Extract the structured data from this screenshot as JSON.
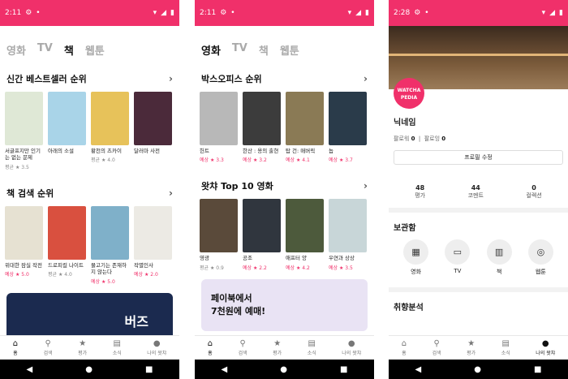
{
  "screen1": {
    "status": {
      "time": "2:11"
    },
    "tabs": [
      "영화",
      "TV",
      "책",
      "웹툰"
    ],
    "section1_title": "신간 베스트셀러 순위",
    "books": [
      {
        "title": "서글프지만 인기는 없는 문제",
        "label": "평균",
        "rating": "★ 3.5"
      },
      {
        "title": "아래의 소설",
        "label": "",
        "rating": ""
      },
      {
        "title": "황천의 츠카이",
        "label": "평균",
        "rating": "★ 4.0"
      },
      {
        "title": "달러마 사전",
        "label": "",
        "rating": ""
      }
    ],
    "section2_title": "책 검색 순위",
    "books2": [
      {
        "title": "위대한 잠실 작전",
        "label": "예상",
        "rating": "★ 5.0"
      },
      {
        "title": "드로피컬 나이트",
        "label": "평균",
        "rating": "★ 4.0"
      },
      {
        "title": "물고기는 존재하지 않는다",
        "label": "예상",
        "rating": "★ 5.0"
      },
      {
        "title": "작별인사",
        "label": "예상",
        "rating": "★ 2.0"
      }
    ],
    "banner_text": "버즈"
  },
  "screen2": {
    "status": {
      "time": "2:11"
    },
    "tabs": [
      "영화",
      "TV",
      "책",
      "웹툰"
    ],
    "section1_title": "박스오피스 순위",
    "movies": [
      {
        "title": "헌트",
        "label": "예상",
        "rating": "★ 3.3"
      },
      {
        "title": "한산 : 용의 출현",
        "label": "예상",
        "rating": "★ 3.2"
      },
      {
        "title": "탑 건: 매버릭",
        "label": "예상",
        "rating": "★ 4.1"
      },
      {
        "title": "놉",
        "label": "예상",
        "rating": "★ 3.7"
      }
    ],
    "section2_title": "왓챠 Top 10 영화",
    "movies2": [
      {
        "title": "영광",
        "label": "평균",
        "rating": "★ 0.9"
      },
      {
        "title": "공조",
        "label": "예상",
        "rating": "★ 2.2"
      },
      {
        "title": "애프터 양",
        "label": "예상",
        "rating": "★ 4.2"
      },
      {
        "title": "우연과 상상",
        "label": "예상",
        "rating": "★ 3.5"
      }
    ],
    "banner_line1": "페이북에서",
    "banner_line2": "7천원에 예매!"
  },
  "screen3": {
    "status": {
      "time": "2:28"
    },
    "logo": "WATCHA PEDIA",
    "nickname": "닉네임",
    "follower_label": "팔로워",
    "follower_count": "0",
    "following_label": "팔로잉",
    "following_count": "0",
    "edit_button": "프로필 수정",
    "stats": [
      {
        "n": "48",
        "l": "평가"
      },
      {
        "n": "44",
        "l": "코멘트"
      },
      {
        "n": "0",
        "l": "컬렉션"
      }
    ],
    "storage_title": "보관함",
    "storage": [
      "영화",
      "TV",
      "책",
      "웹툰"
    ],
    "taste_title": "취향분석"
  },
  "bottom_nav": [
    "홈",
    "검색",
    "평가",
    "소식",
    "나의 왓챠"
  ],
  "colors": {
    "accent": "#f0306a"
  }
}
